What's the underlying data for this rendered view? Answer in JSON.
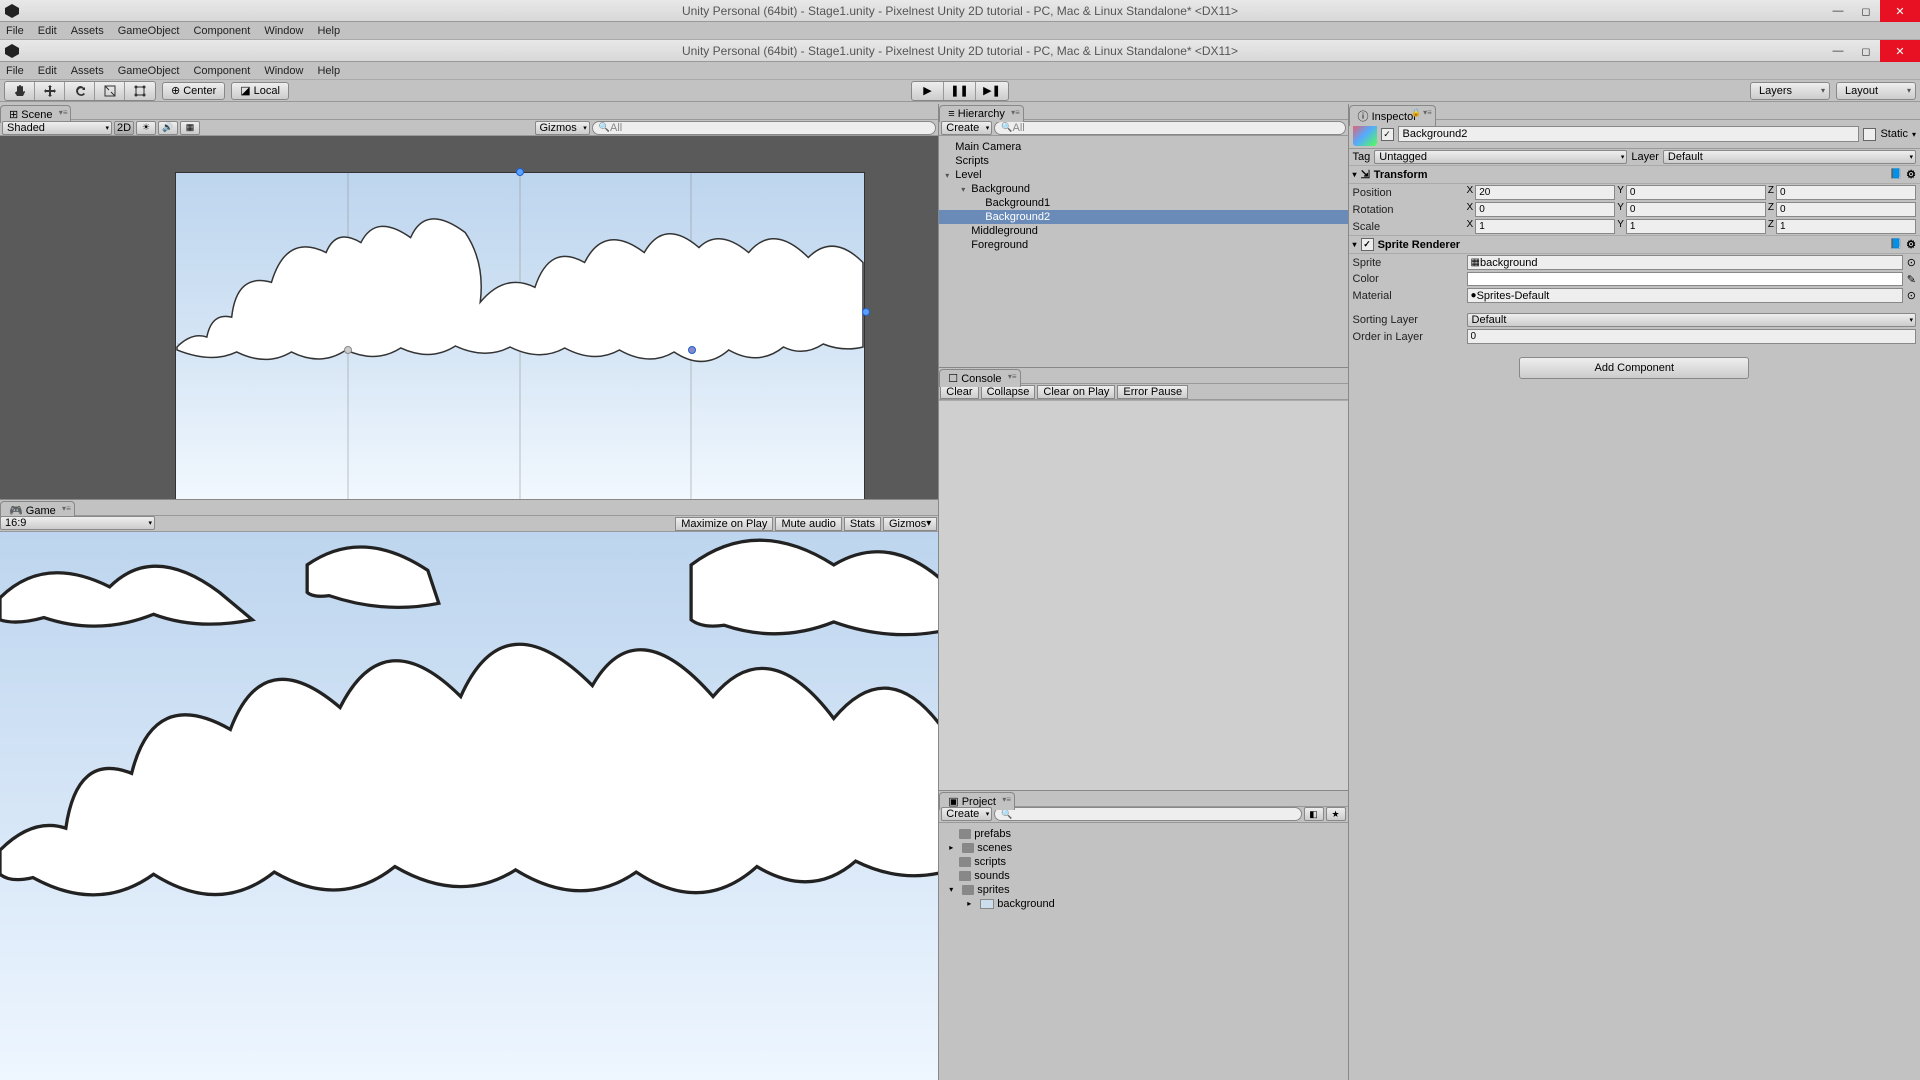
{
  "window": {
    "title_outer": "Unity Personal (64bit) - Stage1.unity - Pixelnest Unity 2D tutorial - PC, Mac & Linux Standalone* <DX11>",
    "title_inner": "Unity Personal (64bit) - Stage1.unity - Pixelnest Unity 2D tutorial - PC, Mac & Linux Standalone* <DX11>"
  },
  "menus": [
    "File",
    "Edit",
    "Assets",
    "GameObject",
    "Component",
    "Window",
    "Help"
  ],
  "toolbar": {
    "center": "Center",
    "local": "Local",
    "layers": "Layers",
    "layout": "Layout"
  },
  "scene": {
    "tab": "Scene",
    "shading": "Shaded",
    "mode2d": "2D",
    "gizmos": "Gizmos",
    "search": "All"
  },
  "game": {
    "tab": "Game",
    "aspect": "16:9",
    "maximize": "Maximize on Play",
    "mute": "Mute audio",
    "stats": "Stats",
    "gizmos": "Gizmos"
  },
  "hierarchy": {
    "tab": "Hierarchy",
    "create": "Create",
    "search": "All",
    "items": {
      "main_camera": "Main Camera",
      "scripts": "Scripts",
      "level": "Level",
      "background": "Background",
      "background1": "Background1",
      "background2": "Background2",
      "middleground": "Middleground",
      "foreground": "Foreground"
    }
  },
  "console": {
    "tab": "Console",
    "clear": "Clear",
    "collapse": "Collapse",
    "clear_on_play": "Clear on Play",
    "error_pause": "Error Pause"
  },
  "project": {
    "tab": "Project",
    "create": "Create",
    "folders": {
      "prefabs": "prefabs",
      "scenes": "scenes",
      "scripts": "scripts",
      "sounds": "sounds",
      "sprites": "sprites",
      "background": "background"
    }
  },
  "inspector": {
    "tab": "Inspector",
    "object_name": "Background2",
    "static": "Static",
    "tag_label": "Tag",
    "tag_value": "Untagged",
    "layer_label": "Layer",
    "layer_value": "Default",
    "transform": {
      "title": "Transform",
      "position": "Position",
      "rotation": "Rotation",
      "scale": "Scale",
      "pos": {
        "x": "20",
        "y": "0",
        "z": "0"
      },
      "rot": {
        "x": "0",
        "y": "0",
        "z": "0"
      },
      "scl": {
        "x": "1",
        "y": "1",
        "z": "1"
      }
    },
    "sprite_renderer": {
      "title": "Sprite Renderer",
      "sprite_label": "Sprite",
      "sprite_value": "background",
      "color_label": "Color",
      "material_label": "Material",
      "material_value": "Sprites-Default",
      "sorting_layer_label": "Sorting Layer",
      "sorting_layer_value": "Default",
      "order_label": "Order in Layer",
      "order_value": "0"
    },
    "add_component": "Add Component"
  }
}
